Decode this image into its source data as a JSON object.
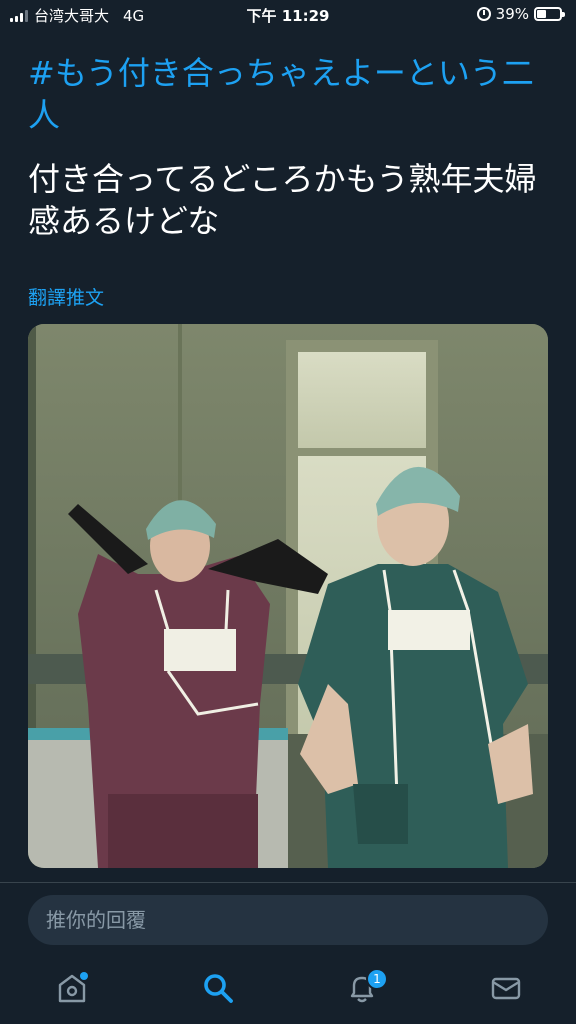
{
  "status_bar": {
    "carrier": "台湾大哥大",
    "network": "4G",
    "time": "下午 11:29",
    "battery_percent": "39%",
    "battery_level": 0.39
  },
  "tweet": {
    "hashtag": "#もう付き合っちゃえよーという二人",
    "text": "付き合ってるどころかもう熟年夫婦感あるけどな",
    "translate_label": "翻譯推文"
  },
  "media": {
    "icon": "photo"
  },
  "reply": {
    "placeholder": "推你的回覆"
  },
  "tab_bar": {
    "notification_count": "1",
    "icons": [
      "home-icon",
      "search-icon",
      "bell-icon",
      "mail-icon"
    ]
  },
  "colors": {
    "background": "#15202b",
    "accent": "#1da1f2",
    "input_bg": "#253341"
  }
}
